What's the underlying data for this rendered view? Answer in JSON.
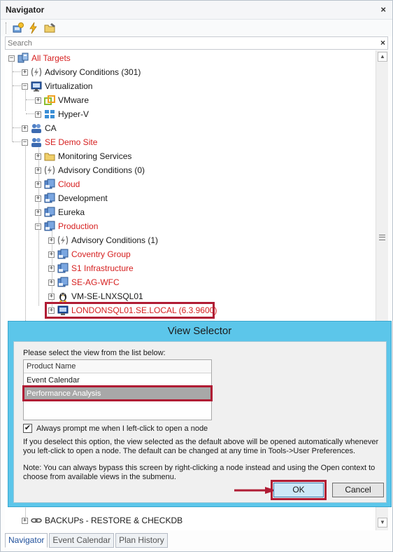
{
  "navigator": {
    "title": "Navigator",
    "close_glyph": "×",
    "toolbar": [
      "add-target-icon",
      "lightning-icon",
      "folder-edit-icon"
    ],
    "search_placeholder": "Search",
    "search_clear": "×",
    "tree": [
      {
        "label": "All Targets",
        "red": true,
        "icon": "targets-icon"
      },
      {
        "label": "Advisory Conditions (301)",
        "red": false,
        "icon": "advisory-icon"
      },
      {
        "label": "Virtualization",
        "red": false,
        "icon": "monitor-icon"
      },
      {
        "label": "VMware",
        "red": false,
        "icon": "vmware-icon"
      },
      {
        "label": "Hyper-V",
        "red": false,
        "icon": "hyperv-icon"
      },
      {
        "label": "CA",
        "red": false,
        "icon": "group-icon"
      },
      {
        "label": "SE Demo Site",
        "red": true,
        "icon": "site-icon"
      },
      {
        "label": "Monitoring Services",
        "red": false,
        "icon": "folder-icon"
      },
      {
        "label": "Advisory Conditions (0)",
        "red": false,
        "icon": "advisory-icon"
      },
      {
        "label": "Cloud",
        "red": true,
        "icon": "server-group-icon"
      },
      {
        "label": "Development",
        "red": false,
        "icon": "server-group-icon"
      },
      {
        "label": "Eureka",
        "red": false,
        "icon": "server-group-icon"
      },
      {
        "label": "Production",
        "red": true,
        "icon": "server-group-icon"
      },
      {
        "label": "Advisory Conditions (1)",
        "red": false,
        "icon": "advisory-icon"
      },
      {
        "label": "Coventry Group",
        "red": true,
        "icon": "server-group-icon"
      },
      {
        "label": "S1 Infrastructure",
        "red": true,
        "icon": "server-group-icon"
      },
      {
        "label": "SE-AG-WFC",
        "red": true,
        "icon": "server-group-icon"
      },
      {
        "label": "VM-SE-LNXSQL01",
        "red": false,
        "icon": "linux-penguin-icon"
      },
      {
        "label": "LONDONSQL01.SE.LOCAL (6.3.9600)",
        "red": true,
        "icon": "sql-server-icon"
      }
    ],
    "bottom_item": {
      "label": "BACKUPs - RESTORE & CHECKDB",
      "icon": "link-icon"
    },
    "tabs": [
      "Navigator",
      "Event Calendar",
      "Plan History"
    ],
    "active_tab": "Navigator"
  },
  "dialog": {
    "title": "View Selector",
    "prompt": "Please select the view from the list below:",
    "list_header": "Product Name",
    "items": [
      "Event Calendar",
      "Performance Analysis"
    ],
    "selected": "Performance Analysis",
    "checkbox_label": "Always prompt me when I left-click to open a node",
    "checked": true,
    "check_glyph": "✔",
    "note1": "If you deselect this option, the view selected as the default above will be opened automatically whenever you left-click to open a node. The default can be changed at any time in Tools->User Preferences.",
    "note2": "Note: You can always bypass this screen by right-clicking a node instead and using the Open context to choose from available views in the submenu.",
    "ok_label": "OK",
    "cancel_label": "Cancel"
  },
  "colors": {
    "red_label": "#d62020",
    "highlight_box": "#b01c34",
    "dialog_frame": "#5cc6ea",
    "selected_item": "#a8a8a8"
  }
}
